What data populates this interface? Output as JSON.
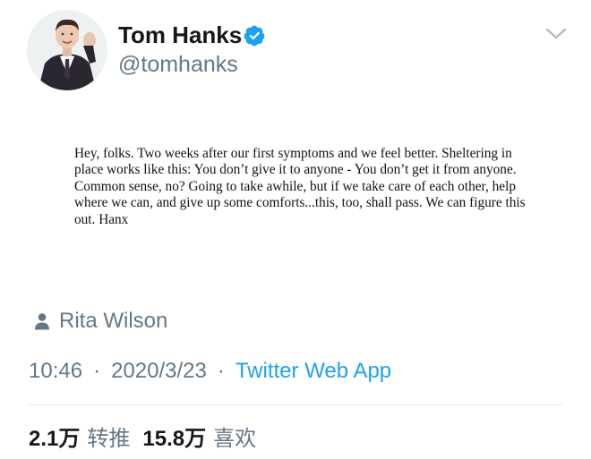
{
  "author": {
    "display_name": "Tom Hanks",
    "handle": "@tomhanks",
    "verified": true,
    "avatar_icon": "profile-photo"
  },
  "tweet": {
    "image_text": "Hey, folks. Two weeks after our first symptoms and we feel better. Sheltering in place works like this: You don’t give it to anyone - You don’t get it from anyone. Common sense, no? Going to take awhile, but if we take care of each other, help where we can, and give up some comforts...this, too, shall pass. We can figure this out.  Hanx",
    "tagged_person": "Rita Wilson",
    "time": "10:46",
    "date": "2020/3/23",
    "separator": "·",
    "source": "Twitter Web App"
  },
  "stats": {
    "retweets_count": "2.1万",
    "retweets_label": "转推",
    "likes_count": "15.8万",
    "likes_label": "喜欢"
  },
  "colors": {
    "text_primary": "#14171a",
    "text_secondary": "#657786",
    "accent": "#1da1f2",
    "divider": "#e1e8ed"
  },
  "icons": {
    "verified": "verified-badge-icon",
    "caret": "chevron-down-icon",
    "tag": "person-icon"
  }
}
